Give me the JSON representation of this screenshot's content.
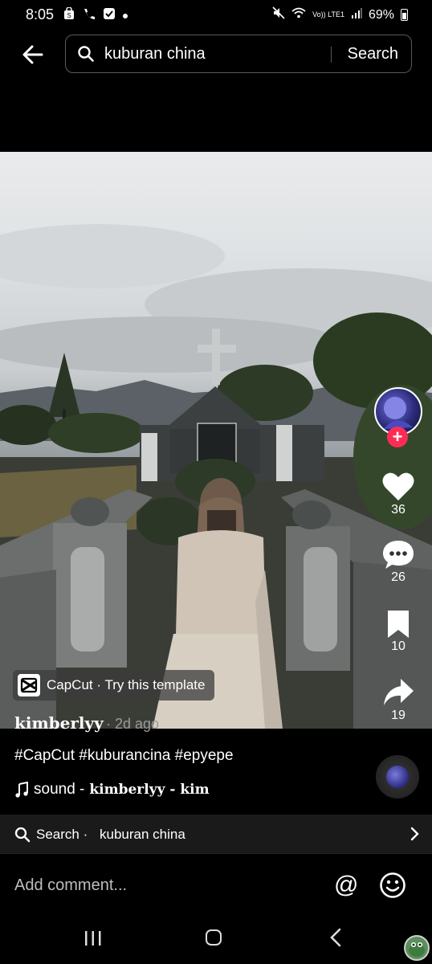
{
  "status_bar": {
    "time": "8:05",
    "network": "Vo)) LTE1",
    "battery": "69%"
  },
  "search": {
    "query": "kuburan china",
    "button_label": "Search"
  },
  "video": {
    "capcut_label": "CapCut · Try this template",
    "username": "kimberlyy",
    "posted": "· 2d ago",
    "hashtags": "#CapCut #kuburancina #epyepe",
    "sound_prefix": "sound -",
    "sound_name": "kimberlyy - kim"
  },
  "actions": {
    "likes": "36",
    "comments": "26",
    "saves": "10",
    "shares": "19"
  },
  "related_search": {
    "label": "Search ·",
    "query": "kuburan china"
  },
  "comment": {
    "placeholder": "Add comment..."
  },
  "colors": {
    "accent": "#fe2c55",
    "background": "#000000"
  }
}
